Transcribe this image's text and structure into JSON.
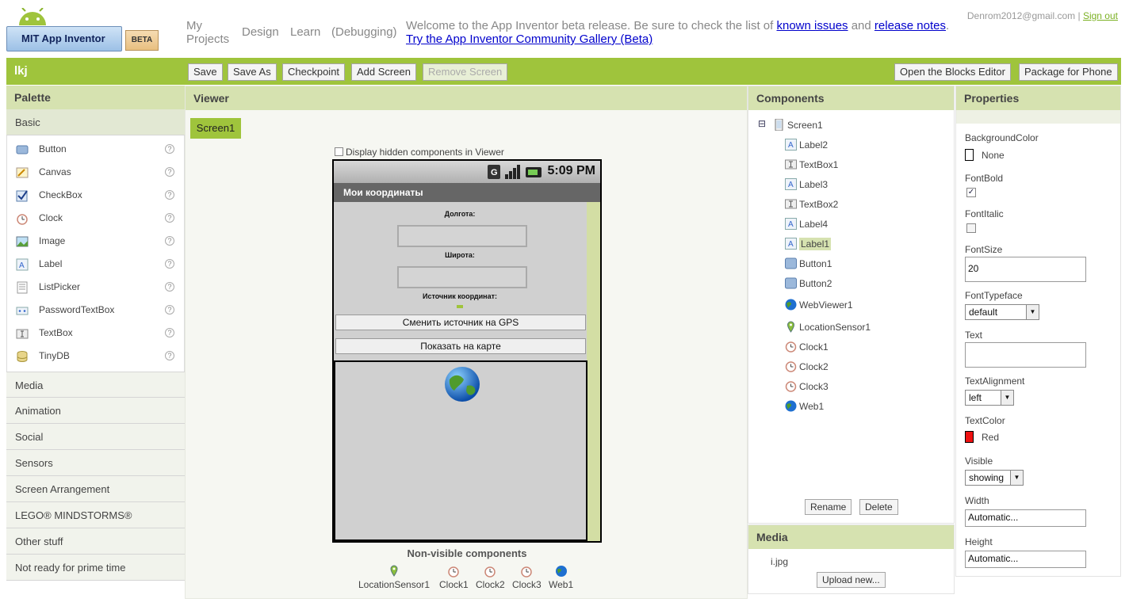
{
  "header": {
    "logo_text": "MIT App Inventor",
    "beta_label": "BETA",
    "nav": [
      "My Projects",
      "Design",
      "Learn",
      "(Debugging)"
    ],
    "welcome_text": "Welcome to the App Inventor beta release. Be sure to check the list of",
    "known_issues_link": "known issues",
    "and_text": "and",
    "release_notes_link": "release notes",
    "try_link": "Try the App Inventor Community Gallery (Beta)",
    "email": "Denrom2012@gmail.com",
    "separator": "|",
    "sign_out": "Sign out"
  },
  "toolbar": {
    "project_name": "lkj",
    "save": "Save",
    "save_as": "Save As",
    "checkpoint": "Checkpoint",
    "add_screen": "Add Screen",
    "remove_screen": "Remove Screen",
    "open_blocks": "Open the Blocks Editor",
    "package_phone": "Package for Phone"
  },
  "palette": {
    "title": "Palette",
    "open_category": "Basic",
    "items": [
      {
        "label": "Button",
        "icon": "button-icon"
      },
      {
        "label": "Canvas",
        "icon": "canvas-icon"
      },
      {
        "label": "CheckBox",
        "icon": "checkbox-icon"
      },
      {
        "label": "Clock",
        "icon": "clock-icon"
      },
      {
        "label": "Image",
        "icon": "image-icon"
      },
      {
        "label": "Label",
        "icon": "label-icon"
      },
      {
        "label": "ListPicker",
        "icon": "listpicker-icon"
      },
      {
        "label": "PasswordTextBox",
        "icon": "password-icon"
      },
      {
        "label": "TextBox",
        "icon": "textbox-icon"
      },
      {
        "label": "TinyDB",
        "icon": "database-icon"
      }
    ],
    "help": "?",
    "categories": [
      "Media",
      "Animation",
      "Social",
      "Sensors",
      "Screen Arrangement",
      "LEGO® MINDSTORMS®",
      "Other stuff",
      "Not ready for prime time"
    ]
  },
  "viewer": {
    "title": "Viewer",
    "screen_tab": "Screen1",
    "hidden_components_label": "Display hidden components in Viewer",
    "phone": {
      "time": "5:09 PM",
      "app_title": "Мои координаты",
      "longitude_label": "Долгота:",
      "latitude_label": "Широта:",
      "source_label": "Источник координат:",
      "gps_button": "Сменить источник на GPS",
      "map_button": "Показать на карте"
    },
    "nonvisible_title": "Non-visible components",
    "nonvisible": [
      {
        "label": "LocationSensor1",
        "icon": "location-pin-icon"
      },
      {
        "label": "Clock1",
        "icon": "clock-icon"
      },
      {
        "label": "Clock2",
        "icon": "clock-icon"
      },
      {
        "label": "Clock3",
        "icon": "clock-icon"
      },
      {
        "label": "Web1",
        "icon": "globe-icon"
      }
    ]
  },
  "components": {
    "title": "Components",
    "tree_toggle": "⊟",
    "root": "Screen1",
    "items": [
      {
        "label": "Label2",
        "icon": "label-icon"
      },
      {
        "label": "TextBox1",
        "icon": "textbox-icon"
      },
      {
        "label": "Label3",
        "icon": "label-icon"
      },
      {
        "label": "TextBox2",
        "icon": "textbox-icon"
      },
      {
        "label": "Label4",
        "icon": "label-icon"
      },
      {
        "label": "Label1",
        "icon": "label-icon",
        "selected": true
      },
      {
        "label": "Button1",
        "icon": "button-icon"
      },
      {
        "label": "Button2",
        "icon": "button-icon"
      },
      {
        "label": "WebViewer1",
        "icon": "globe-icon"
      },
      {
        "label": "LocationSensor1",
        "icon": "location-pin-icon"
      },
      {
        "label": "Clock1",
        "icon": "clock-icon"
      },
      {
        "label": "Clock2",
        "icon": "clock-icon"
      },
      {
        "label": "Clock3",
        "icon": "clock-icon"
      },
      {
        "label": "Web1",
        "icon": "globe-icon"
      }
    ],
    "rename": "Rename",
    "delete": "Delete"
  },
  "media": {
    "title": "Media",
    "file": "i.jpg",
    "upload": "Upload new..."
  },
  "properties": {
    "title": "Properties",
    "background_color_label": "BackgroundColor",
    "background_color_value": "None",
    "font_bold_label": "FontBold",
    "font_bold_checked": true,
    "font_italic_label": "FontItalic",
    "font_size_label": "FontSize",
    "font_size_value": "20",
    "font_typeface_label": "FontTypeface",
    "font_typeface_value": "default",
    "text_label": "Text",
    "text_value": "",
    "text_alignment_label": "TextAlignment",
    "text_alignment_value": "left",
    "text_color_label": "TextColor",
    "text_color_value": "Red",
    "text_color_swatch": "#ee1111",
    "visible_label": "Visible",
    "visible_value": "showing",
    "width_label": "Width",
    "width_value": "Automatic...",
    "height_label": "Height",
    "height_value": "Automatic..."
  },
  "colors": {
    "accent_green": "#9fc43c",
    "panel_header": "#d6e2b0"
  }
}
